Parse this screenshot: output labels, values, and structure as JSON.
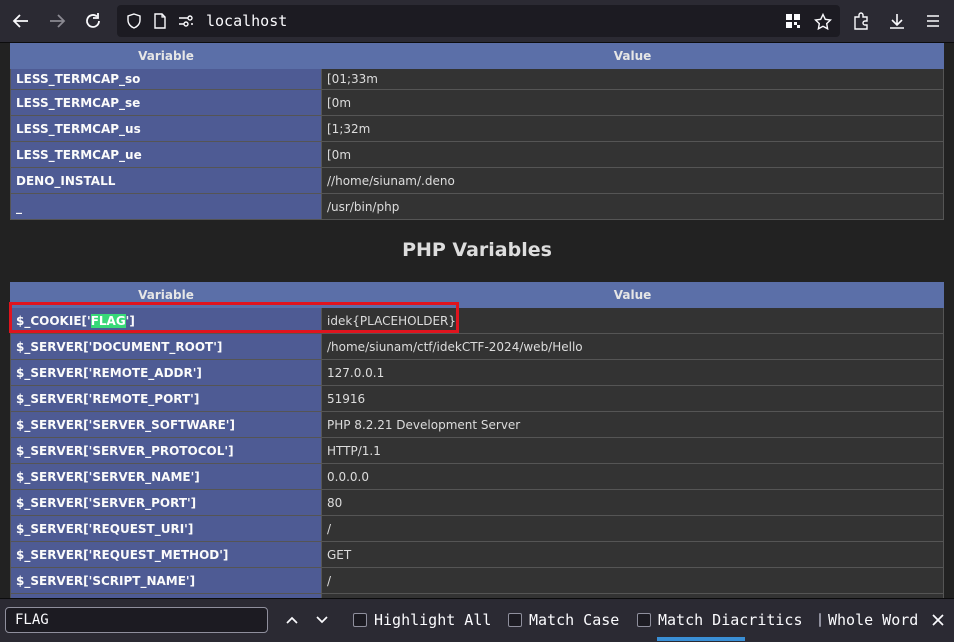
{
  "browser": {
    "url": "localhost"
  },
  "env_table": {
    "headers": [
      "Variable",
      "Value"
    ],
    "rows": [
      {
        "name": "LESS_TERMCAP_so",
        "value": "[01;33m"
      },
      {
        "name": "LESS_TERMCAP_se",
        "value": "[0m"
      },
      {
        "name": "LESS_TERMCAP_us",
        "value": "[1;32m"
      },
      {
        "name": "LESS_TERMCAP_ue",
        "value": "[0m"
      },
      {
        "name": "DENO_INSTALL",
        "value": "//home/siunam/.deno"
      },
      {
        "name": "_",
        "value": "/usr/bin/php"
      }
    ]
  },
  "php_variables": {
    "title": "PHP Variables",
    "headers": [
      "Variable",
      "Value"
    ],
    "cookie_row": {
      "prefix": "$_COOKIE['",
      "highlight": "FLAG",
      "suffix": "']",
      "value": "idek{PLACEHOLDER}"
    },
    "rows": [
      {
        "name": "$_SERVER['DOCUMENT_ROOT']",
        "value": "/home/siunam/ctf/idekCTF-2024/web/Hello"
      },
      {
        "name": "$_SERVER['REMOTE_ADDR']",
        "value": "127.0.0.1"
      },
      {
        "name": "$_SERVER['REMOTE_PORT']",
        "value": "51916"
      },
      {
        "name": "$_SERVER['SERVER_SOFTWARE']",
        "value": "PHP 8.2.21 Development Server"
      },
      {
        "name": "$_SERVER['SERVER_PROTOCOL']",
        "value": "HTTP/1.1"
      },
      {
        "name": "$_SERVER['SERVER_NAME']",
        "value": "0.0.0.0"
      },
      {
        "name": "$_SERVER['SERVER_PORT']",
        "value": "80"
      },
      {
        "name": "$_SERVER['REQUEST_URI']",
        "value": "/"
      },
      {
        "name": "$_SERVER['REQUEST_METHOD']",
        "value": "GET"
      },
      {
        "name": "$_SERVER['SCRIPT_NAME']",
        "value": "/"
      }
    ]
  },
  "findbar": {
    "query": "FLAG",
    "options": [
      "Highlight All",
      "Match Case",
      "Match Diacritics",
      "Whole Words"
    ],
    "checked": [
      false,
      false,
      false,
      false
    ]
  },
  "colors": {
    "header_bg": "#5b6fa8",
    "name_cell_bg": "#4e5b94",
    "value_cell_bg": "#333333",
    "highlight": "#38d878",
    "callout_border": "#e0141e"
  }
}
